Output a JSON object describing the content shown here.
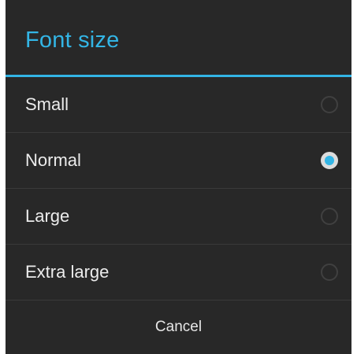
{
  "dialog": {
    "title": "Font size",
    "options": [
      {
        "label": "Small",
        "selected": false
      },
      {
        "label": "Normal",
        "selected": true
      },
      {
        "label": "Large",
        "selected": false
      },
      {
        "label": "Extra large",
        "selected": false
      }
    ],
    "cancel_label": "Cancel"
  },
  "colors": {
    "accent": "#33b5e5",
    "background": "#282828",
    "text": "#ececec"
  }
}
